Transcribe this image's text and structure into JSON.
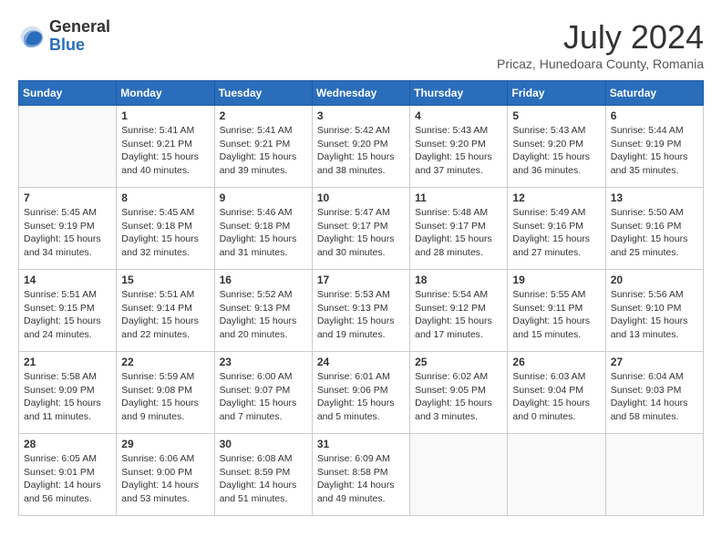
{
  "header": {
    "logo_general": "General",
    "logo_blue": "Blue",
    "month_title": "July 2024",
    "location": "Pricaz, Hunedoara County, Romania"
  },
  "weekdays": [
    "Sunday",
    "Monday",
    "Tuesday",
    "Wednesday",
    "Thursday",
    "Friday",
    "Saturday"
  ],
  "weeks": [
    [
      {
        "day": "",
        "content": ""
      },
      {
        "day": "1",
        "content": "Sunrise: 5:41 AM\nSunset: 9:21 PM\nDaylight: 15 hours\nand 40 minutes."
      },
      {
        "day": "2",
        "content": "Sunrise: 5:41 AM\nSunset: 9:21 PM\nDaylight: 15 hours\nand 39 minutes."
      },
      {
        "day": "3",
        "content": "Sunrise: 5:42 AM\nSunset: 9:20 PM\nDaylight: 15 hours\nand 38 minutes."
      },
      {
        "day": "4",
        "content": "Sunrise: 5:43 AM\nSunset: 9:20 PM\nDaylight: 15 hours\nand 37 minutes."
      },
      {
        "day": "5",
        "content": "Sunrise: 5:43 AM\nSunset: 9:20 PM\nDaylight: 15 hours\nand 36 minutes."
      },
      {
        "day": "6",
        "content": "Sunrise: 5:44 AM\nSunset: 9:19 PM\nDaylight: 15 hours\nand 35 minutes."
      }
    ],
    [
      {
        "day": "7",
        "content": "Sunrise: 5:45 AM\nSunset: 9:19 PM\nDaylight: 15 hours\nand 34 minutes."
      },
      {
        "day": "8",
        "content": "Sunrise: 5:45 AM\nSunset: 9:18 PM\nDaylight: 15 hours\nand 32 minutes."
      },
      {
        "day": "9",
        "content": "Sunrise: 5:46 AM\nSunset: 9:18 PM\nDaylight: 15 hours\nand 31 minutes."
      },
      {
        "day": "10",
        "content": "Sunrise: 5:47 AM\nSunset: 9:17 PM\nDaylight: 15 hours\nand 30 minutes."
      },
      {
        "day": "11",
        "content": "Sunrise: 5:48 AM\nSunset: 9:17 PM\nDaylight: 15 hours\nand 28 minutes."
      },
      {
        "day": "12",
        "content": "Sunrise: 5:49 AM\nSunset: 9:16 PM\nDaylight: 15 hours\nand 27 minutes."
      },
      {
        "day": "13",
        "content": "Sunrise: 5:50 AM\nSunset: 9:16 PM\nDaylight: 15 hours\nand 25 minutes."
      }
    ],
    [
      {
        "day": "14",
        "content": "Sunrise: 5:51 AM\nSunset: 9:15 PM\nDaylight: 15 hours\nand 24 minutes."
      },
      {
        "day": "15",
        "content": "Sunrise: 5:51 AM\nSunset: 9:14 PM\nDaylight: 15 hours\nand 22 minutes."
      },
      {
        "day": "16",
        "content": "Sunrise: 5:52 AM\nSunset: 9:13 PM\nDaylight: 15 hours\nand 20 minutes."
      },
      {
        "day": "17",
        "content": "Sunrise: 5:53 AM\nSunset: 9:13 PM\nDaylight: 15 hours\nand 19 minutes."
      },
      {
        "day": "18",
        "content": "Sunrise: 5:54 AM\nSunset: 9:12 PM\nDaylight: 15 hours\nand 17 minutes."
      },
      {
        "day": "19",
        "content": "Sunrise: 5:55 AM\nSunset: 9:11 PM\nDaylight: 15 hours\nand 15 minutes."
      },
      {
        "day": "20",
        "content": "Sunrise: 5:56 AM\nSunset: 9:10 PM\nDaylight: 15 hours\nand 13 minutes."
      }
    ],
    [
      {
        "day": "21",
        "content": "Sunrise: 5:58 AM\nSunset: 9:09 PM\nDaylight: 15 hours\nand 11 minutes."
      },
      {
        "day": "22",
        "content": "Sunrise: 5:59 AM\nSunset: 9:08 PM\nDaylight: 15 hours\nand 9 minutes."
      },
      {
        "day": "23",
        "content": "Sunrise: 6:00 AM\nSunset: 9:07 PM\nDaylight: 15 hours\nand 7 minutes."
      },
      {
        "day": "24",
        "content": "Sunrise: 6:01 AM\nSunset: 9:06 PM\nDaylight: 15 hours\nand 5 minutes."
      },
      {
        "day": "25",
        "content": "Sunrise: 6:02 AM\nSunset: 9:05 PM\nDaylight: 15 hours\nand 3 minutes."
      },
      {
        "day": "26",
        "content": "Sunrise: 6:03 AM\nSunset: 9:04 PM\nDaylight: 15 hours\nand 0 minutes."
      },
      {
        "day": "27",
        "content": "Sunrise: 6:04 AM\nSunset: 9:03 PM\nDaylight: 14 hours\nand 58 minutes."
      }
    ],
    [
      {
        "day": "28",
        "content": "Sunrise: 6:05 AM\nSunset: 9:01 PM\nDaylight: 14 hours\nand 56 minutes."
      },
      {
        "day": "29",
        "content": "Sunrise: 6:06 AM\nSunset: 9:00 PM\nDaylight: 14 hours\nand 53 minutes."
      },
      {
        "day": "30",
        "content": "Sunrise: 6:08 AM\nSunset: 8:59 PM\nDaylight: 14 hours\nand 51 minutes."
      },
      {
        "day": "31",
        "content": "Sunrise: 6:09 AM\nSunset: 8:58 PM\nDaylight: 14 hours\nand 49 minutes."
      },
      {
        "day": "",
        "content": ""
      },
      {
        "day": "",
        "content": ""
      },
      {
        "day": "",
        "content": ""
      }
    ]
  ]
}
